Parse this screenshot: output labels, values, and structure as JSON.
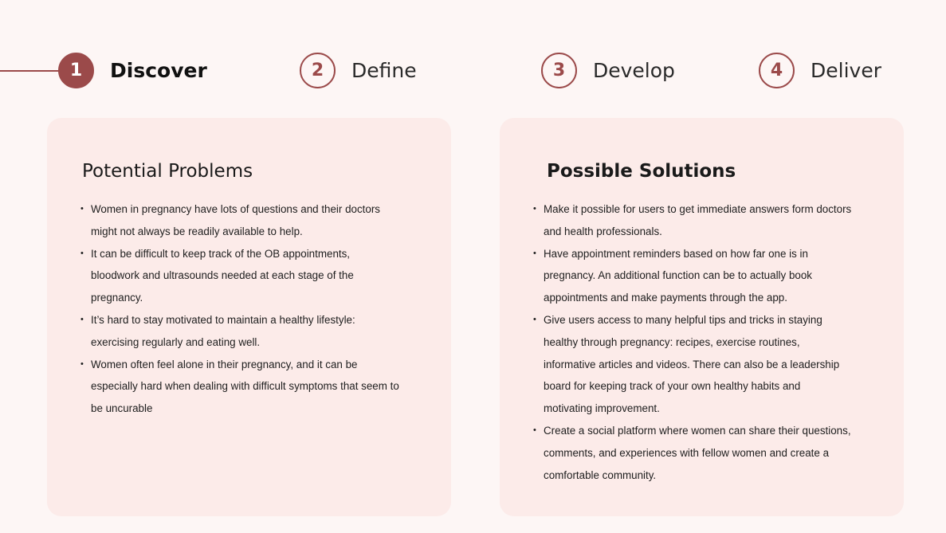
{
  "steps": [
    {
      "number": "1",
      "label": "Discover",
      "active": true
    },
    {
      "number": "2",
      "label": "Define",
      "active": false
    },
    {
      "number": "3",
      "label": "Develop",
      "active": false
    },
    {
      "number": "4",
      "label": "Deliver",
      "active": false
    }
  ],
  "problems": {
    "title": "Potential Problems",
    "items": [
      "Women in pregnancy have lots of questions and their doctors might not always be readily available to help.",
      "It can be difficult to keep track of the OB appointments, bloodwork and ultrasounds needed at each stage of the pregnancy.",
      "It’s hard to stay motivated to maintain a healthy lifestyle: exercising regularly and eating well.",
      "Women often feel alone in their pregnancy, and it can be especially hard when dealing with difficult symptoms that seem to be uncurable"
    ]
  },
  "solutions": {
    "title": "Possible Solutions",
    "items": [
      "Make it possible for users to get immediate answers form doctors and health professionals.",
      "Have appointment reminders based on how far one is in pregnancy. An additional function can be to actually book appointments and make payments through the app.",
      "Give users access to many helpful tips and tricks in staying healthy through pregnancy: recipes, exercise routines, informative articles and videos. There can also be a leadership board for keeping track of your own healthy habits and motivating improvement.",
      "Create a social platform where women can share their questions, comments, and experiences with fellow women and create a comfortable community."
    ]
  },
  "colors": {
    "accent": "#9b4a4a",
    "background": "#fdf6f5",
    "card": "#fcebe9"
  }
}
